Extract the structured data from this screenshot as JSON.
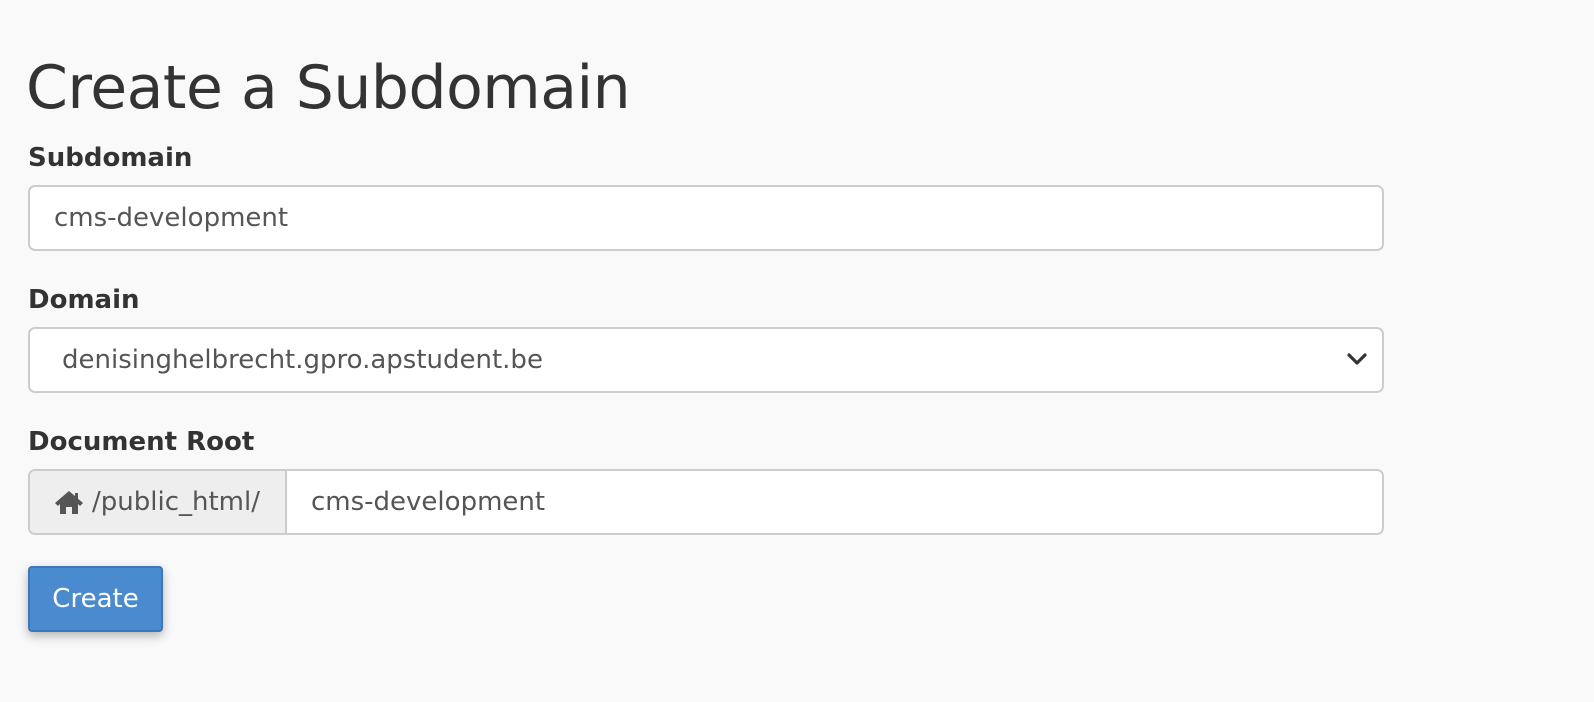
{
  "page": {
    "title": "Create a Subdomain"
  },
  "form": {
    "subdomain": {
      "label": "Subdomain",
      "value": "cms-development"
    },
    "domain": {
      "label": "Domain",
      "selected": "denisinghelbrecht.gpro.apstudent.be",
      "icon": "chevron-down-icon"
    },
    "document_root": {
      "label": "Document Root",
      "prefix": "/public_html/",
      "prefix_icon": "home-icon",
      "value": "cms-development"
    },
    "submit_label": "Create"
  },
  "colors": {
    "background": "#f9f9f9",
    "text": "#333333",
    "input_border": "#cccccc",
    "addon_background": "#eeeeee",
    "button_primary": "#4a8bd0"
  }
}
